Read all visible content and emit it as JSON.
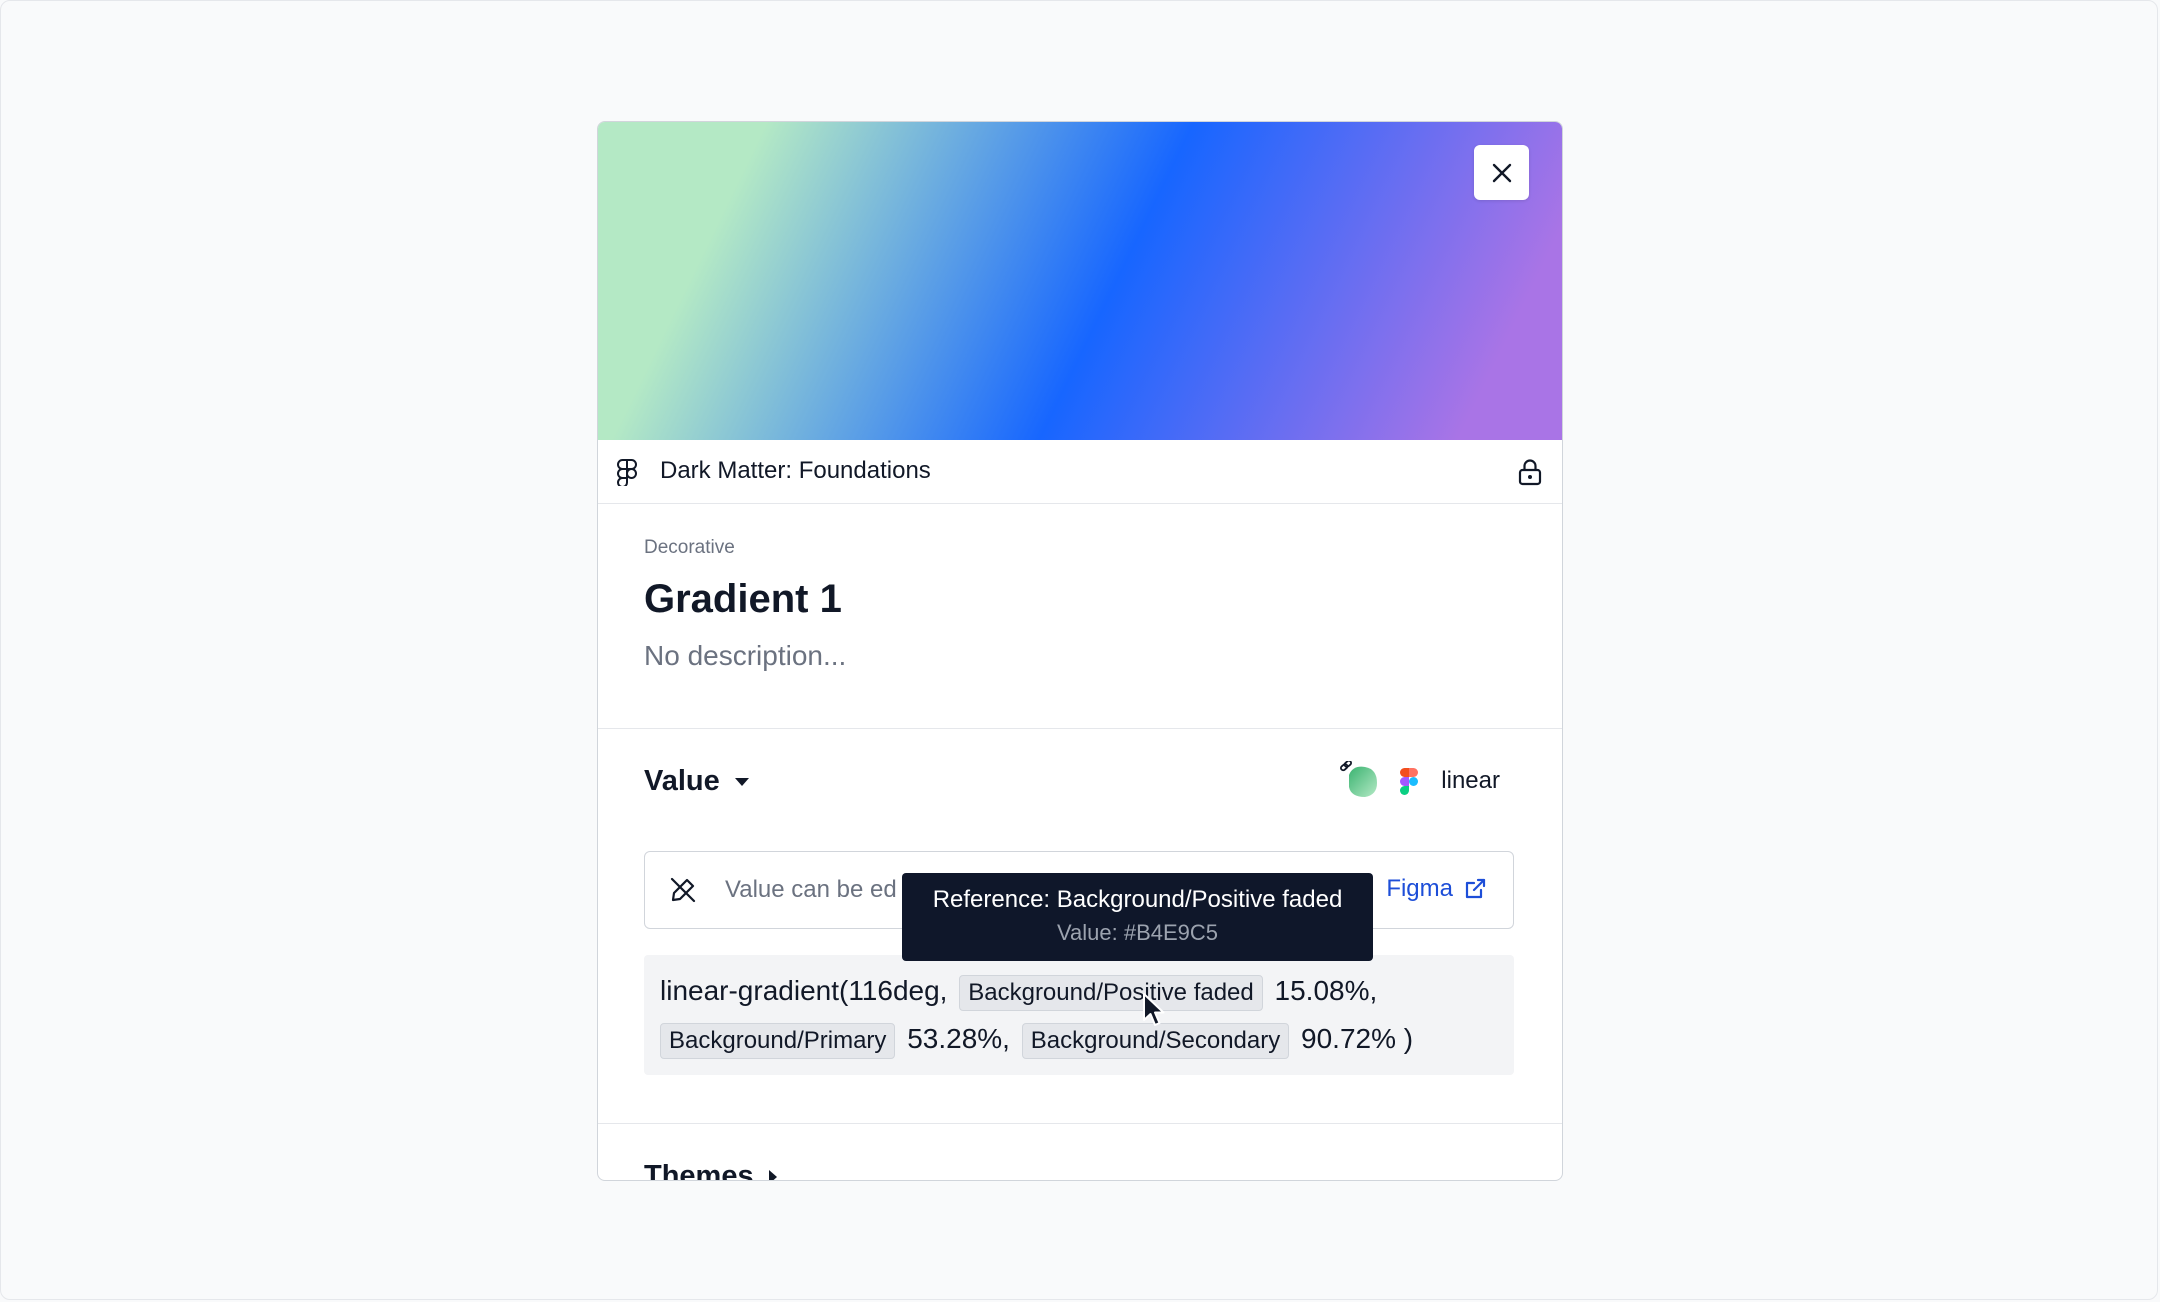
{
  "source": {
    "name": "Dark Matter: Foundations"
  },
  "token": {
    "category": "Decorative",
    "title": "Gradient 1",
    "description": "No description..."
  },
  "value_section": {
    "label": "Value",
    "type": "linear",
    "notice_text": "Value can be ed",
    "figma_link": "Figma",
    "code": {
      "prefix": "linear-gradient(116deg,",
      "stop1_ref": "Background/Positive faded",
      "stop1_pct": "15.08%,",
      "stop2_ref": "Background/Primary",
      "stop2_pct": "53.28%,",
      "stop3_ref": "Background/Secondary",
      "stop3_pct": "90.72% )"
    }
  },
  "themes_section": {
    "label": "Themes"
  },
  "tooltip": {
    "line1": "Reference: Background/Positive faded",
    "line2": "Value: #B4E9C5"
  },
  "colors": {
    "gradient_stop1": "#B4E9C5",
    "gradient_stop2": "#1766FF",
    "gradient_stop3": "#A974E6",
    "link": "#1d4ed8",
    "tooltip_bg": "#0f172a"
  },
  "icons": [
    "close-icon",
    "figma-icon",
    "lock-icon",
    "caret-down-icon",
    "linked-token-icon",
    "figma-color-icon",
    "pen-off-icon",
    "external-link-icon",
    "caret-right-icon",
    "cursor-icon"
  ]
}
